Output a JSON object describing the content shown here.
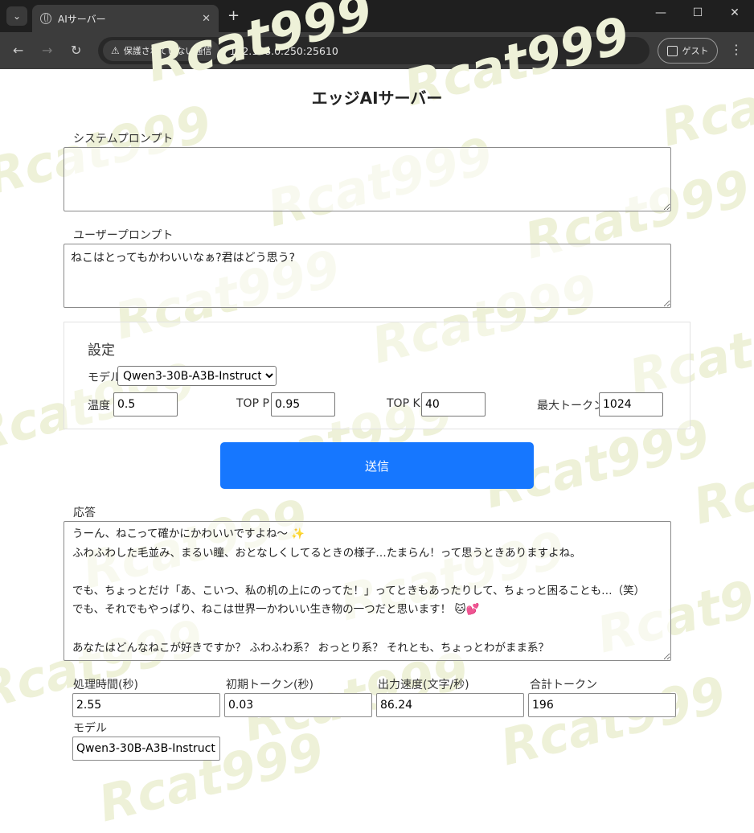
{
  "browser": {
    "tab_title": "AIサーバー",
    "security_label": "保護されていない通信",
    "url": "192.168.0.250:25610",
    "profile_label": "ゲスト"
  },
  "watermark_text": "Rcat999",
  "page": {
    "title": "エッジAIサーバー",
    "system_prompt": {
      "label": "システムプロンプト",
      "value": ""
    },
    "user_prompt": {
      "label": "ユーザープロンプト",
      "value": "ねこはとってもかわいいなぁ?君はどう思う?"
    },
    "settings": {
      "title": "設定",
      "model_label": "モデル",
      "model_selected": "Qwen3-30B-A3B-Instruct",
      "temperature_label": "温度",
      "temperature": "0.5",
      "top_p_label": "TOP P",
      "top_p": "0.95",
      "top_k_label": "TOP K",
      "top_k": "40",
      "max_tokens_label": "最大トークン",
      "max_tokens": "1024"
    },
    "send_label": "送信",
    "response": {
      "label": "応答",
      "text": "うーん、ねこって確かにかわいいですよね〜 ✨\nふわふわした毛並み、まるい瞳、おとなしくしてるときの様子…たまらん！って思うときありますよね。\n\nでも、ちょっとだけ「あ、こいつ、私の机の上にのってた！」ってときもあったりして、ちょっと困ることも…（笑）\nでも、それでもやっぱり、ねこは世界一かわいい生き物の一つだと思います！ 🐱💕\n\nあなたはどんなねこが好きですか？ ふわふわ系？ おっとり系？ それとも、ちょっとわがまま系？"
    },
    "stats": {
      "processing_time_label": "処理時間(秒)",
      "processing_time": "2.55",
      "first_token_label": "初期トークン(秒)",
      "first_token": "0.03",
      "output_speed_label": "出力速度(文字/秒)",
      "output_speed": "86.24",
      "total_tokens_label": "合計トークン",
      "total_tokens": "196",
      "model_label": "モデル",
      "model": "Qwen3-30B-A3B-Instruct"
    }
  }
}
